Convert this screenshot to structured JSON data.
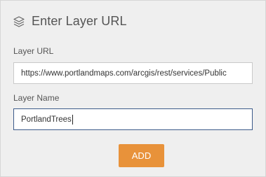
{
  "header": {
    "title": "Enter Layer URL",
    "icon": "layers-icon"
  },
  "layer_url": {
    "label": "Layer URL",
    "value": "https://www.portlandmaps.com/arcgis/rest/services/Public"
  },
  "layer_name": {
    "label": "Layer Name",
    "value": "PortlandTrees"
  },
  "actions": {
    "add_label": "ADD"
  },
  "colors": {
    "accent": "#e8923a",
    "focus_border": "#3c5b8a"
  }
}
